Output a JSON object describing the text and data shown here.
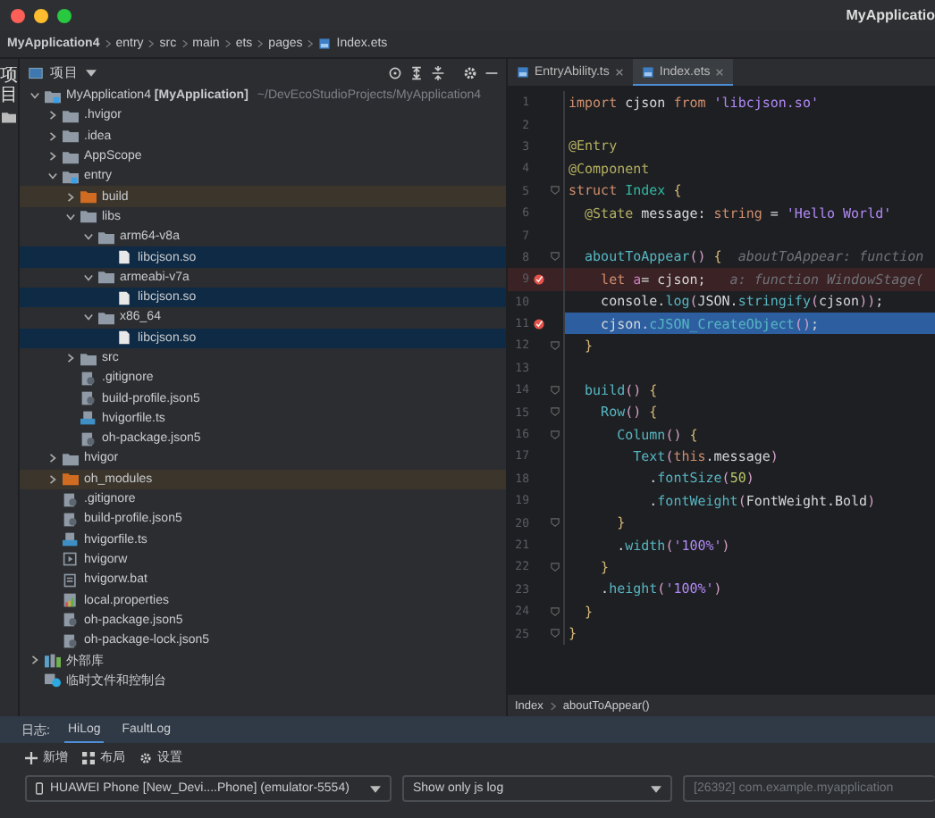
{
  "window": {
    "title": "MyApplicatio"
  },
  "breadcrumbs": [
    {
      "label": "MyApplication4",
      "kind": "project"
    },
    {
      "label": "entry",
      "kind": "folder"
    },
    {
      "label": "src",
      "kind": "folder"
    },
    {
      "label": "main",
      "kind": "folder"
    },
    {
      "label": "ets",
      "kind": "folder"
    },
    {
      "label": "pages",
      "kind": "folder"
    },
    {
      "label": "Index.ets",
      "kind": "file"
    }
  ],
  "side_strip": {
    "label": "项目"
  },
  "project_panel": {
    "title": "项目"
  },
  "tree": [
    {
      "label": "MyApplication4 **[MyApplication]**",
      "location": "~/DevEcoStudioProjects/MyApplication4",
      "kind": "module",
      "expanded": true,
      "selected": false,
      "children": [
        {
          "label": ".hvigor",
          "kind": "folder",
          "expanded": false,
          "selected": false
        },
        {
          "label": ".idea",
          "kind": "folder",
          "expanded": false,
          "selected": false
        },
        {
          "label": "AppScope",
          "kind": "folder",
          "expanded": false,
          "selected": false
        },
        {
          "label": "entry",
          "kind": "module",
          "expanded": true,
          "selected": false,
          "children": [
            {
              "label": "build",
              "kind": "excluded-folder",
              "expanded": false,
              "selected": false
            },
            {
              "label": "libs",
              "kind": "folder",
              "expanded": true,
              "selected": false,
              "children": [
                {
                  "label": "arm64-v8a",
                  "kind": "folder",
                  "expanded": true,
                  "selected": false,
                  "children": [
                    {
                      "label": "libcjson.so",
                      "kind": "file",
                      "selected": true
                    }
                  ]
                },
                {
                  "label": "armeabi-v7a",
                  "kind": "folder",
                  "expanded": true,
                  "selected": false,
                  "children": [
                    {
                      "label": "libcjson.so",
                      "kind": "file",
                      "selected": true
                    }
                  ]
                },
                {
                  "label": "x86_64",
                  "kind": "folder",
                  "expanded": true,
                  "selected": false,
                  "children": [
                    {
                      "label": "libcjson.so",
                      "kind": "file",
                      "selected": true
                    }
                  ]
                }
              ]
            },
            {
              "label": "src",
              "kind": "folder",
              "expanded": false,
              "selected": false
            },
            {
              "label": ".gitignore",
              "kind": "config",
              "selected": false
            },
            {
              "label": "build-profile.json5",
              "kind": "config",
              "selected": false
            },
            {
              "label": "hvigorfile.ts",
              "kind": "ts-file",
              "selected": false
            },
            {
              "label": "oh-package.json5",
              "kind": "config",
              "selected": false
            }
          ]
        },
        {
          "label": "hvigor",
          "kind": "folder",
          "expanded": false,
          "selected": false
        },
        {
          "label": "oh_modules",
          "kind": "excluded-folder",
          "expanded": false,
          "selected": false
        },
        {
          "label": ".gitignore",
          "kind": "config",
          "selected": false
        },
        {
          "label": "build-profile.json5",
          "kind": "config",
          "selected": false
        },
        {
          "label": "hvigorfile.ts",
          "kind": "ts-file",
          "selected": false
        },
        {
          "label": "hvigorw",
          "kind": "script",
          "selected": false
        },
        {
          "label": "hvigorw.bat",
          "kind": "text-file",
          "selected": false
        },
        {
          "label": "local.properties",
          "kind": "properties",
          "selected": false
        },
        {
          "label": "oh-package.json5",
          "kind": "config",
          "selected": false
        },
        {
          "label": "oh-package-lock.json5",
          "kind": "config",
          "selected": false
        }
      ]
    },
    {
      "label": "外部库",
      "kind": "library",
      "expanded": false,
      "selected": false
    },
    {
      "label": "临时文件和控制台",
      "kind": "scratch",
      "selected": false
    }
  ],
  "editor_tabs": [
    {
      "label": "EntryAbility.ts",
      "selected": false
    },
    {
      "label": "Index.ets",
      "selected": true
    }
  ],
  "code_lines": [
    {
      "number": "1",
      "breakpoint": false,
      "current": false,
      "fold": false,
      "tokens": [
        {
          "kind": "kw",
          "text": "import"
        },
        {
          "kind": "plain",
          "text": " cjson "
        },
        {
          "kind": "kw",
          "text": "from"
        },
        {
          "kind": "str",
          "text": " 'libcjson.so'"
        }
      ]
    },
    {
      "number": "2",
      "breakpoint": false,
      "current": false,
      "fold": false
    },
    {
      "number": "3",
      "breakpoint": false,
      "current": false,
      "fold": false,
      "tokens": [
        {
          "kind": "anno",
          "text": "@Entry"
        }
      ]
    },
    {
      "number": "4",
      "breakpoint": false,
      "current": false,
      "fold": false,
      "tokens": [
        {
          "kind": "anno",
          "text": "@Component"
        }
      ]
    },
    {
      "number": "5",
      "breakpoint": false,
      "current": false,
      "fold": true,
      "tokens": [
        {
          "kind": "kw",
          "text": "struct"
        },
        {
          "kind": "type",
          "text": " Index"
        },
        {
          "kind": "brace",
          "text": " {"
        }
      ]
    },
    {
      "number": "6",
      "breakpoint": false,
      "current": false,
      "fold": false,
      "tokens": [
        {
          "kind": "anno",
          "text": "  @State"
        },
        {
          "kind": "plain",
          "text": " message: "
        },
        {
          "kind": "kw",
          "text": "string"
        },
        {
          "kind": "plain",
          "text": " = "
        },
        {
          "kind": "str",
          "text": "'Hello World'"
        }
      ]
    },
    {
      "number": "7",
      "breakpoint": false,
      "current": false,
      "fold": false
    },
    {
      "number": "8",
      "breakpoint": false,
      "current": false,
      "fold": true,
      "tokens": [
        {
          "kind": "fn",
          "text": "  aboutToAppear"
        },
        {
          "kind": "paren",
          "text": "()"
        },
        {
          "kind": "brace",
          "text": " {"
        },
        {
          "kind": "hint",
          "text": "  aboutToAppear: function"
        }
      ]
    },
    {
      "number": "9",
      "breakpoint": true,
      "current": false,
      "fold": false,
      "tokens": [
        {
          "kind": "kw",
          "text": "    let"
        },
        {
          "kind": "local",
          "text": " a"
        },
        {
          "kind": "plain",
          "text": "= cjson;"
        },
        {
          "kind": "hint",
          "text": "   a: function WindowStage("
        }
      ]
    },
    {
      "number": "10",
      "breakpoint": false,
      "current": false,
      "fold": false,
      "tokens": [
        {
          "kind": "plain",
          "text": "    console."
        },
        {
          "kind": "fn",
          "text": "log"
        },
        {
          "kind": "paren",
          "text": "("
        },
        {
          "kind": "plain",
          "text": "JSON."
        },
        {
          "kind": "fn",
          "text": "stringify"
        },
        {
          "kind": "paren",
          "text": "("
        },
        {
          "kind": "plain",
          "text": "cjson"
        },
        {
          "kind": "paren",
          "text": "))"
        },
        {
          "kind": "plain",
          "text": ";"
        }
      ]
    },
    {
      "number": "11",
      "breakpoint": true,
      "current": true,
      "fold": false,
      "tokens": [
        {
          "kind": "plain",
          "text": "    cjson."
        },
        {
          "kind": "fn",
          "text": "cJSON_CreateObject"
        },
        {
          "kind": "paren",
          "text": "()"
        },
        {
          "kind": "plain",
          "text": ";"
        }
      ]
    },
    {
      "number": "12",
      "breakpoint": false,
      "current": false,
      "fold": true,
      "tokens": [
        {
          "kind": "brace",
          "text": "  }"
        }
      ]
    },
    {
      "number": "13",
      "breakpoint": false,
      "current": false,
      "fold": false
    },
    {
      "number": "14",
      "breakpoint": false,
      "current": false,
      "fold": true,
      "tokens": [
        {
          "kind": "fn",
          "text": "  build"
        },
        {
          "kind": "paren",
          "text": "()"
        },
        {
          "kind": "brace",
          "text": " {"
        }
      ]
    },
    {
      "number": "15",
      "breakpoint": false,
      "current": false,
      "fold": true,
      "tokens": [
        {
          "kind": "fn",
          "text": "    Row"
        },
        {
          "kind": "paren",
          "text": "()"
        },
        {
          "kind": "brace",
          "text": " {"
        }
      ]
    },
    {
      "number": "16",
      "breakpoint": false,
      "current": false,
      "fold": true,
      "tokens": [
        {
          "kind": "fn",
          "text": "      Column"
        },
        {
          "kind": "paren",
          "text": "()"
        },
        {
          "kind": "brace",
          "text": " {"
        }
      ]
    },
    {
      "number": "17",
      "breakpoint": false,
      "current": false,
      "fold": false,
      "tokens": [
        {
          "kind": "fn",
          "text": "        Text"
        },
        {
          "kind": "paren",
          "text": "("
        },
        {
          "kind": "kw",
          "text": "this"
        },
        {
          "kind": "plain",
          "text": ".message"
        },
        {
          "kind": "paren",
          "text": ")"
        }
      ]
    },
    {
      "number": "18",
      "breakpoint": false,
      "current": false,
      "fold": false,
      "tokens": [
        {
          "kind": "plain",
          "text": "          ."
        },
        {
          "kind": "fn",
          "text": "fontSize"
        },
        {
          "kind": "paren",
          "text": "("
        },
        {
          "kind": "num",
          "text": "50"
        },
        {
          "kind": "paren",
          "text": ")"
        }
      ]
    },
    {
      "number": "19",
      "breakpoint": false,
      "current": false,
      "fold": false,
      "tokens": [
        {
          "kind": "plain",
          "text": "          ."
        },
        {
          "kind": "fn",
          "text": "fontWeight"
        },
        {
          "kind": "paren",
          "text": "("
        },
        {
          "kind": "plain",
          "text": "FontWeight.Bold"
        },
        {
          "kind": "paren",
          "text": ")"
        }
      ]
    },
    {
      "number": "20",
      "breakpoint": false,
      "current": false,
      "fold": true,
      "tokens": [
        {
          "kind": "brace",
          "text": "      }"
        }
      ]
    },
    {
      "number": "21",
      "breakpoint": false,
      "current": false,
      "fold": false,
      "tokens": [
        {
          "kind": "plain",
          "text": "      ."
        },
        {
          "kind": "fn",
          "text": "width"
        },
        {
          "kind": "paren",
          "text": "("
        },
        {
          "kind": "str",
          "text": "'100%'"
        },
        {
          "kind": "paren",
          "text": ")"
        }
      ]
    },
    {
      "number": "22",
      "breakpoint": false,
      "current": false,
      "fold": true,
      "tokens": [
        {
          "kind": "brace",
          "text": "    }"
        }
      ]
    },
    {
      "number": "23",
      "breakpoint": false,
      "current": false,
      "fold": false,
      "tokens": [
        {
          "kind": "plain",
          "text": "    ."
        },
        {
          "kind": "fn",
          "text": "height"
        },
        {
          "kind": "paren",
          "text": "("
        },
        {
          "kind": "str",
          "text": "'100%'"
        },
        {
          "kind": "paren",
          "text": ")"
        }
      ]
    },
    {
      "number": "24",
      "breakpoint": false,
      "current": false,
      "fold": true,
      "tokens": [
        {
          "kind": "brace",
          "text": "  }"
        }
      ]
    },
    {
      "number": "25",
      "breakpoint": false,
      "current": false,
      "fold": true,
      "tokens": [
        {
          "kind": "brace",
          "text": "}"
        }
      ]
    }
  ],
  "editor_breadcrumbs": [
    "Index",
    "aboutToAppear()"
  ],
  "log_panel": {
    "label": "日志:",
    "tabs": [
      {
        "label": "HiLog",
        "selected": true
      },
      {
        "label": "FaultLog",
        "selected": false
      }
    ],
    "toolbar": [
      {
        "label": "新增",
        "kind": "add"
      },
      {
        "label": "布局",
        "kind": "layout"
      },
      {
        "label": "设置",
        "kind": "settings"
      }
    ],
    "device": "HUAWEI Phone [New_Devi....Phone] (emulator-5554)",
    "filter": "Show only js log",
    "process": "[26392] com.example.myapplication"
  }
}
